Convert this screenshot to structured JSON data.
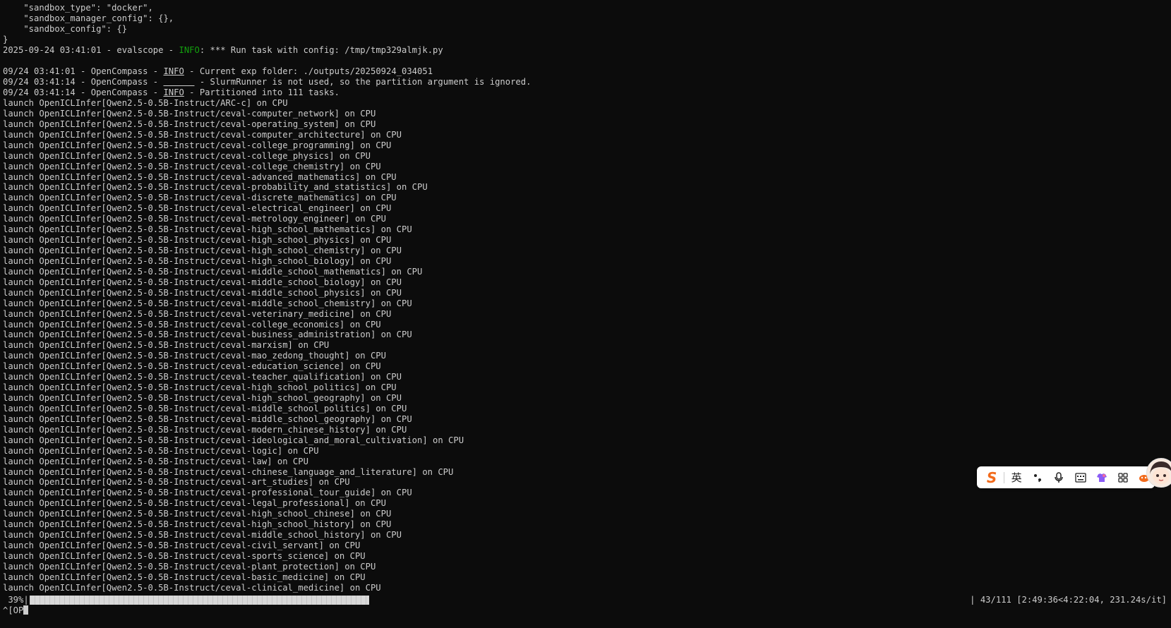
{
  "terminal": {
    "config_lines": [
      "    \"sandbox_type\": \"docker\",",
      "    \"sandbox_manager_config\": {},",
      "    \"sandbox_config\": {}",
      "}"
    ],
    "evalscope_line": {
      "prefix": "2025-09-24 03:41:01 - evalscope - ",
      "level": "INFO",
      "message": ": *** Run task with config: /tmp/tmp329almjk.py"
    },
    "opencompass_lines": [
      {
        "prefix": "09/24 03:41:01 - OpenCompass - ",
        "level": "INFO",
        "message": " - Current exp folder: ./outputs/20250924_034051"
      },
      {
        "prefix": "09/24 03:41:14 - OpenCompass - ",
        "level": "______",
        "message": " - SlurmRunner is not used, so the partition argument is ignored."
      },
      {
        "prefix": "09/24 03:41:14 - OpenCompass - ",
        "level": "INFO",
        "message": " - Partitioned into 111 tasks."
      }
    ],
    "launch_prefix": "launch OpenICLInfer[Qwen2.5-0.5B-Instruct/",
    "launch_suffix": "] on CPU",
    "tasks": [
      "ARC-c",
      "ceval-computer_network",
      "ceval-operating_system",
      "ceval-computer_architecture",
      "ceval-college_programming",
      "ceval-college_physics",
      "ceval-college_chemistry",
      "ceval-advanced_mathematics",
      "ceval-probability_and_statistics",
      "ceval-discrete_mathematics",
      "ceval-electrical_engineer",
      "ceval-metrology_engineer",
      "ceval-high_school_mathematics",
      "ceval-high_school_physics",
      "ceval-high_school_chemistry",
      "ceval-high_school_biology",
      "ceval-middle_school_mathematics",
      "ceval-middle_school_biology",
      "ceval-middle_school_physics",
      "ceval-middle_school_chemistry",
      "ceval-veterinary_medicine",
      "ceval-college_economics",
      "ceval-business_administration",
      "ceval-marxism",
      "ceval-mao_zedong_thought",
      "ceval-education_science",
      "ceval-teacher_qualification",
      "ceval-high_school_politics",
      "ceval-high_school_geography",
      "ceval-middle_school_politics",
      "ceval-middle_school_geography",
      "ceval-modern_chinese_history",
      "ceval-ideological_and_moral_cultivation",
      "ceval-logic",
      "ceval-law",
      "ceval-chinese_language_and_literature",
      "ceval-art_studies",
      "ceval-professional_tour_guide",
      "ceval-legal_professional",
      "ceval-high_school_chinese",
      "ceval-high_school_history",
      "ceval-middle_school_history",
      "ceval-civil_servant",
      "ceval-sports_science",
      "ceval-plant_protection",
      "ceval-basic_medicine",
      "ceval-clinical_medicine"
    ],
    "progress": {
      "percent_label": " 39%|",
      "fraction": 0.39,
      "rate_text": "| 43/111 [2:49:36<4:22:04, 231.24s/it]"
    },
    "prompt_text": "^[OP"
  },
  "ime_toolbar": {
    "logo": "S",
    "lang_label": "英",
    "punct_label": "•,",
    "icons": [
      "sogou-logo-icon",
      "microphone-icon",
      "keyboard-icon",
      "skin-icon",
      "grid-icon",
      "tools-icon"
    ]
  },
  "colors": {
    "background": "#0c0c0c",
    "text": "#cccccc",
    "info_green": "#13a10e",
    "ime_orange": "#f26a1b"
  }
}
